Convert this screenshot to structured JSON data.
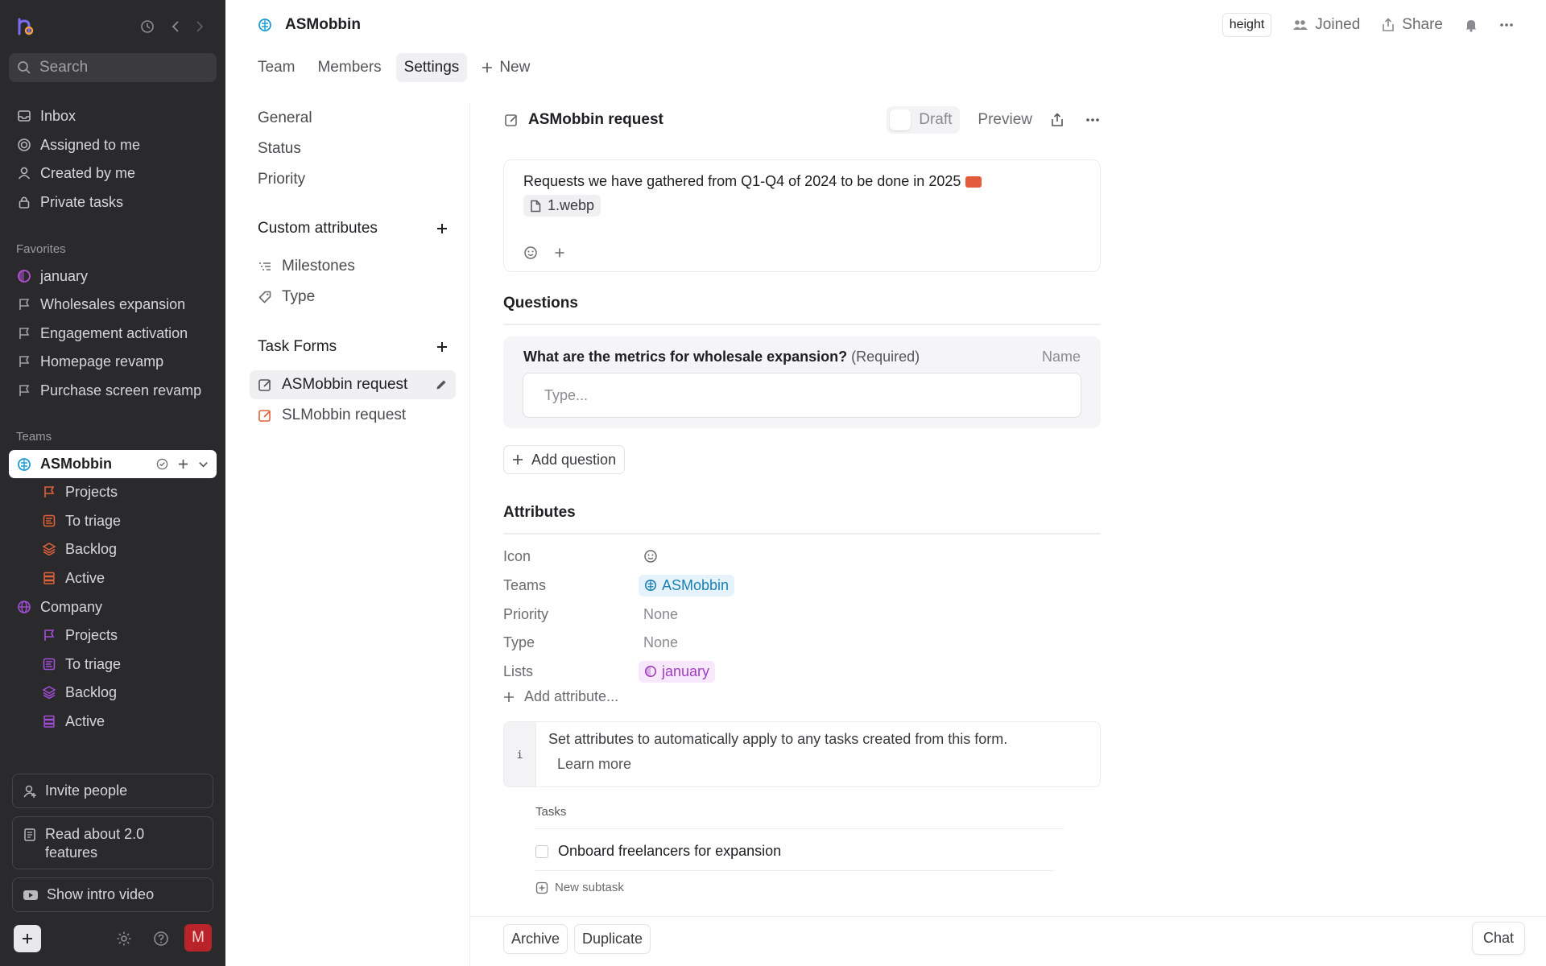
{
  "sidebar": {
    "search_placeholder": "Search",
    "nav": [
      {
        "label": "Inbox",
        "icon": "inbox-icon"
      },
      {
        "label": "Assigned to me",
        "icon": "target-icon"
      },
      {
        "label": "Created by me",
        "icon": "user-icon"
      },
      {
        "label": "Private tasks",
        "icon": "lock-icon"
      }
    ],
    "favorites_title": "Favorites",
    "favorites": [
      {
        "label": "january",
        "icon": "list-circle-icon"
      },
      {
        "label": "Wholesales expansion",
        "icon": "flag-icon"
      },
      {
        "label": "Engagement activation",
        "icon": "flag-icon"
      },
      {
        "label": "Homepage revamp",
        "icon": "flag-icon"
      },
      {
        "label": "Purchase screen revamp",
        "icon": "flag-icon"
      }
    ],
    "teams_title": "Teams",
    "team_active": "ASMobbin",
    "team_sub": [
      "Projects",
      "To triage",
      "Backlog",
      "Active"
    ],
    "company": "Company",
    "company_sub": [
      "Projects",
      "To triage",
      "Backlog",
      "Active"
    ],
    "invite": "Invite people",
    "read_about": "Read about 2.0 features",
    "intro_video": "Show intro video",
    "avatar_letter": "M"
  },
  "header": {
    "title": "ASMobbin",
    "badge": "height",
    "joined": "Joined",
    "share": "Share",
    "tabs": [
      {
        "label": "Team",
        "active": false
      },
      {
        "label": "Members",
        "active": false
      },
      {
        "label": "Settings",
        "active": true
      }
    ],
    "new_label": "New"
  },
  "settings_nav": {
    "items": [
      "General",
      "Status",
      "Priority"
    ],
    "custom_attributes_title": "Custom attributes",
    "custom_attributes": [
      "Milestones",
      "Type"
    ],
    "task_forms_title": "Task Forms",
    "task_forms": [
      "ASMobbin request",
      "SLMobbin request"
    ]
  },
  "form": {
    "title": "ASMobbin request",
    "draft": "Draft",
    "preview": "Preview",
    "description": "Requests we have gathered from Q1-Q4 of 2024 to be done in 2025",
    "attachment": "1.webp",
    "questions_title": "Questions",
    "question": "What are the metrics for wholesale expansion?",
    "required": "(Required)",
    "question_type": "Name",
    "input_placeholder": "Type...",
    "add_question": "Add question",
    "attributes_title": "Attributes",
    "attributes": {
      "icon_label": "Icon",
      "teams_label": "Teams",
      "teams_value": "ASMobbin",
      "priority_label": "Priority",
      "priority_value": "None",
      "type_label": "Type",
      "type_value": "None",
      "lists_label": "Lists",
      "lists_value": "january"
    },
    "add_attribute": "Add attribute...",
    "info_marker": "i",
    "info_text": "Set attributes to automatically apply to any tasks created from this form.",
    "learn_more": "Learn more",
    "tasks_title": "Tasks",
    "task": "Onboard freelancers for expansion",
    "new_subtask": "New subtask",
    "archive": "Archive",
    "duplicate": "Duplicate",
    "chat": "Chat"
  },
  "colors": {
    "sidebar_bg": "#2a2a2c",
    "team_blue": "#1a9bd7",
    "project_orange": "#e0613a",
    "company_purple": "#a24fd8",
    "january_purple": "#b452d6",
    "avatar_red": "#b9232a"
  }
}
